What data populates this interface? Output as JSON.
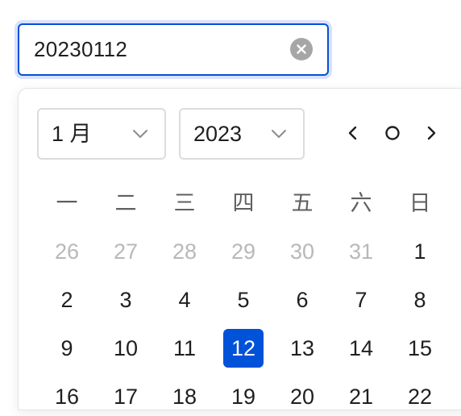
{
  "input": {
    "value": "20230112"
  },
  "header": {
    "month": "1 月",
    "year": "2023"
  },
  "weekdays": [
    "一",
    "二",
    "三",
    "四",
    "五",
    "六",
    "日"
  ],
  "weeks": [
    [
      {
        "label": "26",
        "other": true
      },
      {
        "label": "27",
        "other": true
      },
      {
        "label": "28",
        "other": true
      },
      {
        "label": "29",
        "other": true
      },
      {
        "label": "30",
        "other": true
      },
      {
        "label": "31",
        "other": true
      },
      {
        "label": "1"
      }
    ],
    [
      {
        "label": "2"
      },
      {
        "label": "3"
      },
      {
        "label": "4"
      },
      {
        "label": "5"
      },
      {
        "label": "6"
      },
      {
        "label": "7"
      },
      {
        "label": "8"
      }
    ],
    [
      {
        "label": "9"
      },
      {
        "label": "10"
      },
      {
        "label": "11"
      },
      {
        "label": "12",
        "selected": true
      },
      {
        "label": "13"
      },
      {
        "label": "14"
      },
      {
        "label": "15"
      }
    ],
    [
      {
        "label": "16"
      },
      {
        "label": "17"
      },
      {
        "label": "18"
      },
      {
        "label": "19"
      },
      {
        "label": "20"
      },
      {
        "label": "21"
      },
      {
        "label": "22"
      }
    ]
  ],
  "icons": {
    "clear": "close-circle-icon",
    "month_dropdown": "chevron-down-icon",
    "year_dropdown": "chevron-down-icon",
    "prev": "chevron-left-icon",
    "today": "circle-icon",
    "next": "chevron-right-icon"
  },
  "colors": {
    "accent": "#0052d9",
    "focus_ring": "#d9e1ff",
    "muted_day": "#b8b8b8",
    "weekday": "#5f5f5f",
    "clear_icon_bg": "#a6a6a6"
  }
}
